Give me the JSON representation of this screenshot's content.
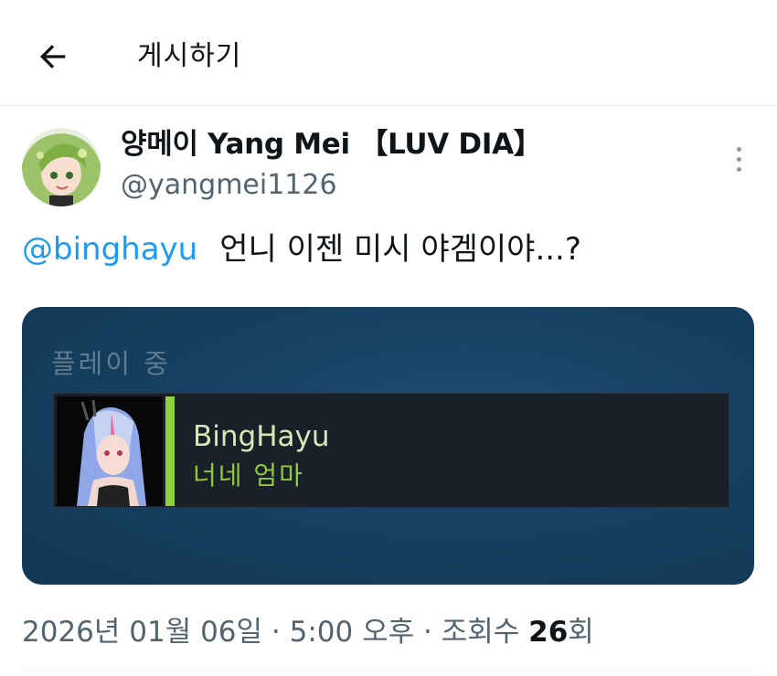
{
  "header": {
    "title": "게시하기",
    "back_icon": "arrow-left-icon"
  },
  "tweet": {
    "author": {
      "display_name": "양메이 Yang Mei 【LUV DIA】",
      "handle": "@yangmei1126",
      "avatar_icon": "profile-avatar"
    },
    "more_icon": "more-vertical-icon",
    "mention": "@binghayu",
    "text": "언니 이젠 미시 야겜이야...?",
    "media": {
      "playing_label": "플레이 중",
      "friend_name": "BingHayu",
      "game_name": "너네 엄마",
      "status_color": "#8fd13a"
    },
    "meta": {
      "date": "2026년 01월 06일",
      "separator": "·",
      "time": "5:00 오후",
      "views_label_prefix": "조회수",
      "views_count": "26",
      "views_label_suffix": "회"
    }
  },
  "colors": {
    "accent": "#1d9bf0",
    "secondary_text": "#536471",
    "card_bg": "#153e5e",
    "friend_bar_bg": "#1a2027",
    "game_text": "#8fc83a"
  }
}
